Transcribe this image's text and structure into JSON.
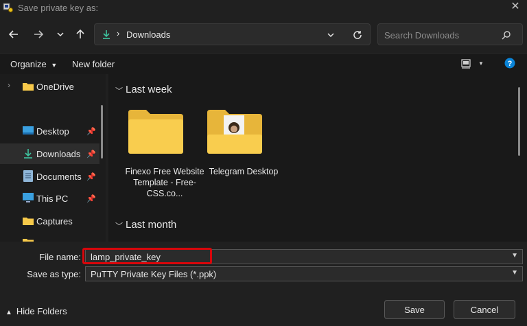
{
  "window": {
    "title": "Save private key as:"
  },
  "nav": {
    "address_label": "Downloads",
    "search_placeholder": "Search Downloads"
  },
  "toolbar": {
    "organize_label": "Organize",
    "new_folder_label": "New folder"
  },
  "sidebar": {
    "items": [
      {
        "label": "OneDrive",
        "icon": "cloud-folder-icon"
      },
      {
        "label": "Desktop",
        "icon": "desktop-icon",
        "pinned": true
      },
      {
        "label": "Downloads",
        "icon": "download-icon",
        "pinned": true,
        "selected": true
      },
      {
        "label": "Documents",
        "icon": "document-icon",
        "pinned": true
      },
      {
        "label": "This PC",
        "icon": "computer-icon",
        "pinned": true
      },
      {
        "label": "Captures",
        "icon": "folder-icon"
      }
    ]
  },
  "main": {
    "groups": [
      {
        "label": "Last week",
        "items": [
          {
            "label": "Finexo Free Website Template - Free-CSS.co..."
          },
          {
            "label": "Telegram Desktop"
          }
        ]
      },
      {
        "label": "Last month"
      }
    ]
  },
  "bottom": {
    "file_name_label": "File name:",
    "file_name_value": "lamp_private_key",
    "save_type_label": "Save as type:",
    "save_type_value": "PuTTY Private Key Files (*.ppk)",
    "hide_folders_label": "Hide Folders",
    "save_label": "Save",
    "cancel_label": "Cancel"
  },
  "colors": {
    "accent": "#0a84d8",
    "highlight": "#d8060b",
    "folder": "#f7c94a"
  }
}
